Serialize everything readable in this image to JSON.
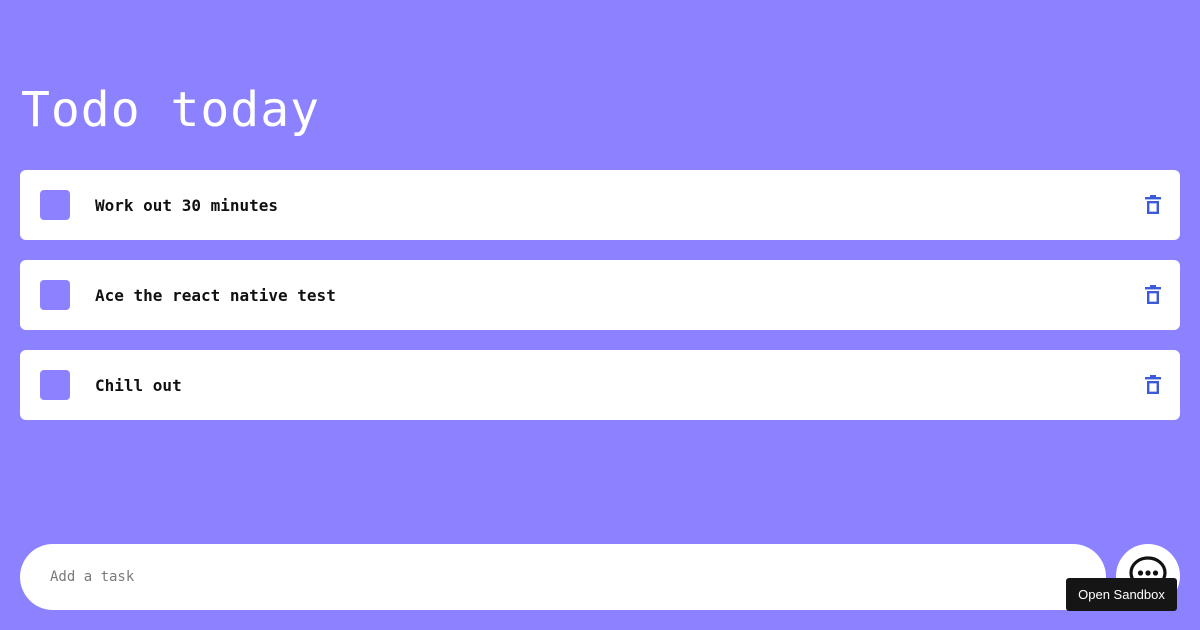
{
  "page": {
    "title": "Todo today",
    "background_color": "#8c82ff"
  },
  "tasks": [
    {
      "label": "Work out 30 minutes",
      "completed": false,
      "checkbox_color": "#8c82ff",
      "delete_icon": "trash-icon"
    },
    {
      "label": "Ace the react native test",
      "completed": false,
      "checkbox_color": "#8c82ff",
      "delete_icon": "trash-icon"
    },
    {
      "label": "Chill out",
      "completed": false,
      "checkbox_color": "#8c82ff",
      "delete_icon": "trash-icon"
    }
  ],
  "input": {
    "placeholder": "Add a task",
    "value": ""
  },
  "add_button": {
    "icon": "chat-bubble-icon"
  },
  "sandbox_button": {
    "label": "Open Sandbox"
  },
  "colors": {
    "accent": "#8c82ff",
    "card": "#ffffff",
    "delete_icon": "#3b5bdb",
    "tooltip_bg": "#151515"
  }
}
